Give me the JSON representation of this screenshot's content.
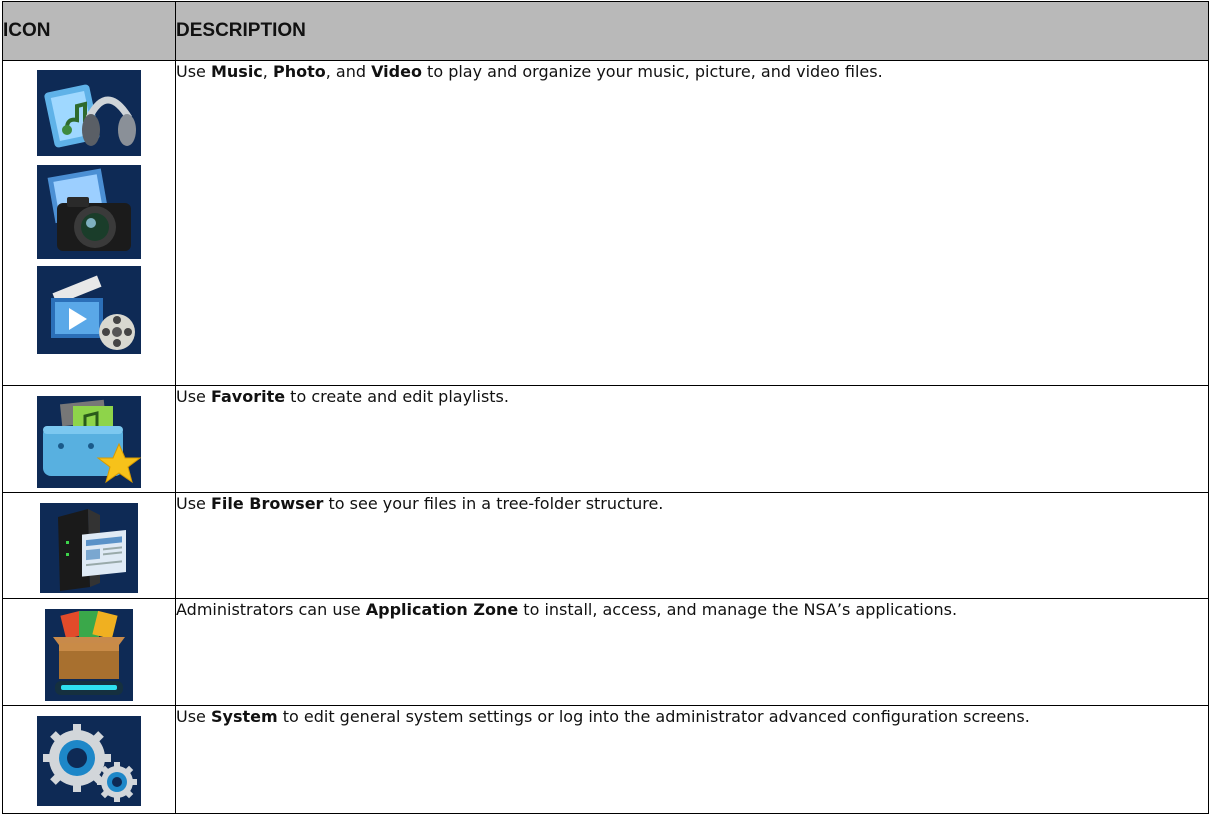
{
  "table": {
    "headers": {
      "icon": "ICON",
      "description": "DESCRIPTION"
    },
    "rows": [
      {
        "icons": [
          "music-icon",
          "photo-icon",
          "video-icon"
        ],
        "text": [
          {
            "t": "Use "
          },
          {
            "t": "Music",
            "b": true
          },
          {
            "t": ", "
          },
          {
            "t": "Photo",
            "b": true
          },
          {
            "t": ", and "
          },
          {
            "t": "Video",
            "b": true
          },
          {
            "t": " to play and organize your music, picture, and video files."
          }
        ]
      },
      {
        "icons": [
          "favorite-icon"
        ],
        "text": [
          {
            "t": "Use "
          },
          {
            "t": "Favorite",
            "b": true
          },
          {
            "t": " to create and edit playlists."
          }
        ]
      },
      {
        "icons": [
          "file-browser-icon"
        ],
        "text": [
          {
            "t": "Use "
          },
          {
            "t": "File Browser",
            "b": true
          },
          {
            "t": " to see your files in a tree-folder structure."
          }
        ]
      },
      {
        "icons": [
          "application-zone-icon"
        ],
        "text": [
          {
            "t": "Administrators can use "
          },
          {
            "t": "Application Zone",
            "b": true
          },
          {
            "t": " to install, access, and manage the NSA’s applications."
          }
        ]
      },
      {
        "icons": [
          "system-icon"
        ],
        "text": [
          {
            "t": "Use "
          },
          {
            "t": "System",
            "b": true
          },
          {
            "t": " to edit general system settings or log into the administrator advanced configuration screens."
          }
        ]
      }
    ]
  },
  "colors": {
    "header_bg": "#b9b9b9",
    "border": "#000000",
    "icon_bg": "#0e2a55"
  }
}
